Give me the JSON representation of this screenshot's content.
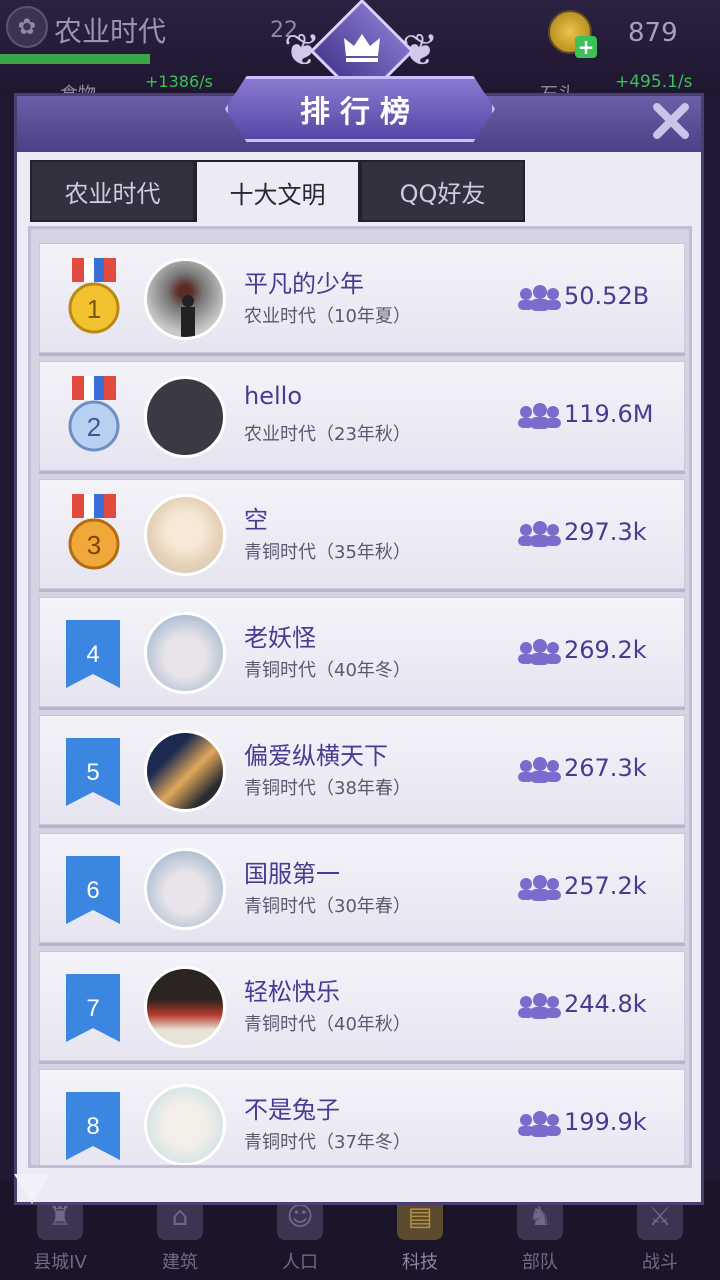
{
  "hud": {
    "era_title": "农业时代",
    "middle_text": "22",
    "coins": "879",
    "rate_left": "+1386/s",
    "rate_right": "+495.1/s",
    "food_label": "食物",
    "stone_label": "石头"
  },
  "modal": {
    "title": "排行榜",
    "close_icon": "close-icon",
    "tabs": [
      {
        "label": "农业时代",
        "active": false
      },
      {
        "label": "十大文明",
        "active": true
      },
      {
        "label": "QQ好友",
        "active": false
      }
    ]
  },
  "rankings": [
    {
      "rank": "1",
      "name": "平凡的少年",
      "era": "农业时代（10年夏）",
      "population": "50.52B",
      "medal": "gold"
    },
    {
      "rank": "2",
      "name": "hello",
      "era": "农业时代（23年秋）",
      "population": "119.6M",
      "medal": "silver"
    },
    {
      "rank": "3",
      "name": "空",
      "era": "青铜时代（35年秋）",
      "population": "297.3k",
      "medal": "bronze"
    },
    {
      "rank": "4",
      "name": "老妖怪",
      "era": "青铜时代（40年冬）",
      "population": "269.2k"
    },
    {
      "rank": "5",
      "name": "偏爱纵横天下",
      "era": "青铜时代（38年春）",
      "population": "267.3k"
    },
    {
      "rank": "6",
      "name": "国服第一",
      "era": "青铜时代（30年春）",
      "population": "257.2k"
    },
    {
      "rank": "7",
      "name": "轻松快乐",
      "era": "青铜时代（40年秋）",
      "population": "244.8k"
    },
    {
      "rank": "8",
      "name": "不是兔子",
      "era": "青铜时代（37年冬）",
      "population": "199.9k"
    }
  ],
  "bottom_nav": [
    {
      "label": "县城IV",
      "icon": "castle-icon"
    },
    {
      "label": "建筑",
      "icon": "house-icon"
    },
    {
      "label": "人口",
      "icon": "person-icon"
    },
    {
      "label": "科技",
      "icon": "book-icon",
      "active": true
    },
    {
      "label": "部队",
      "icon": "helmet-icon"
    },
    {
      "label": "战斗",
      "icon": "swords-icon"
    }
  ],
  "colors": {
    "accent": "#473c92",
    "header": "#5b4d9e",
    "gold": "#f2c230",
    "silver": "#b8d0f2",
    "bronze": "#f0a83a",
    "flag_blue": "#3b86e0"
  }
}
